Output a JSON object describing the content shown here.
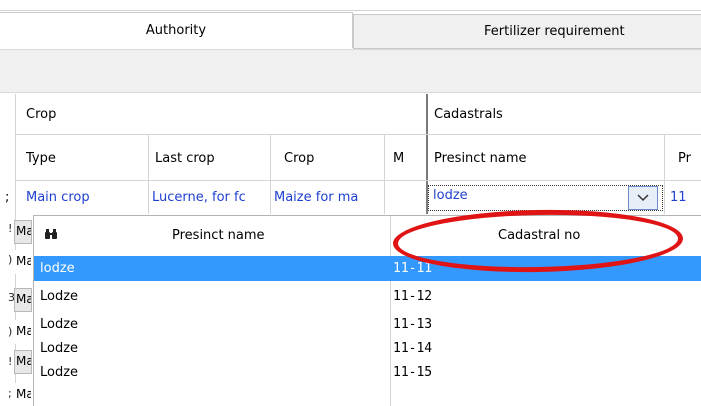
{
  "tabs": [
    {
      "label": "Authority"
    },
    {
      "label": "Fertilizer requirement"
    }
  ],
  "grid": {
    "groups": {
      "crop": "Crop",
      "cadastrals": "Cadastrals"
    },
    "columns": {
      "type": "Type",
      "last_crop": "Last crop",
      "crop": "Crop",
      "m": "M",
      "presinct_name": "Presinct name",
      "pr": "Pr"
    },
    "current_row": {
      "type": "Main crop",
      "last_crop": "Lucerne, for fc",
      "crop": "Maize for ma",
      "presinct_name": "lodze",
      "pr": "11"
    },
    "stub_rows": [
      "Ma",
      "Ma",
      "Ma",
      "Ma",
      "Ma",
      "Ma"
    ],
    "stub_marks": [
      ";",
      "!",
      ")",
      "3",
      ")",
      "!",
      ";"
    ]
  },
  "dropdown": {
    "columns": {
      "presinct_name": "Presinct name",
      "cadastral_no": "Cadastral no"
    },
    "search_icon": "binoculars-icon",
    "rows": [
      {
        "presinct_name": "lodze",
        "cadastral_no": "11-11",
        "selected": true
      },
      {
        "presinct_name": "Lodze",
        "cadastral_no": "11-12",
        "selected": false
      },
      {
        "presinct_name": "Lodze",
        "cadastral_no": "11-13",
        "selected": false
      },
      {
        "presinct_name": "Lodze",
        "cadastral_no": "11-14",
        "selected": false
      },
      {
        "presinct_name": "Lodze",
        "cadastral_no": "11-15",
        "selected": false
      }
    ]
  },
  "colors": {
    "selection": "#3399ff",
    "link_text": "#1f3fd0",
    "annotation": "#e01414"
  }
}
